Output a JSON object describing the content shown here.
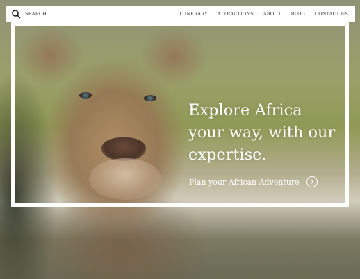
{
  "header": {
    "search_label": "SEARCH",
    "nav": [
      {
        "label": "ITINERARY"
      },
      {
        "label": "ATTRACTIONS"
      },
      {
        "label": "ABOUT"
      },
      {
        "label": "BLOG"
      },
      {
        "label": "CONTACT US"
      }
    ]
  },
  "hero": {
    "headline": "Explore Africa your way, with our expertise.",
    "cta_label": "Plan your African Adventure",
    "cta_icon": "chevron-right-circle-icon",
    "image": "lioness-photo"
  },
  "colors": {
    "text": "#ffffff",
    "nav_text": "#333333",
    "bar_bg": "#ffffff"
  }
}
